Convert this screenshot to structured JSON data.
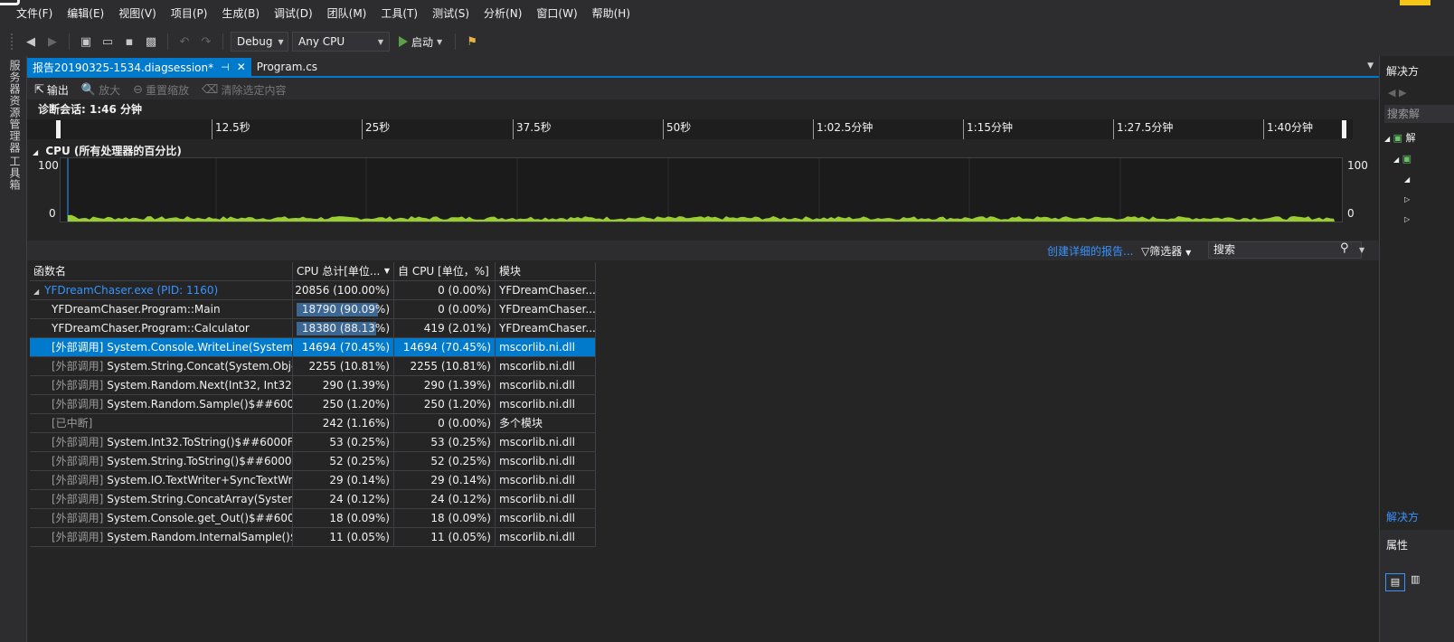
{
  "menu": [
    "文件(F)",
    "编辑(E)",
    "视图(V)",
    "项目(P)",
    "生成(B)",
    "调试(D)",
    "团队(M)",
    "工具(T)",
    "测试(S)",
    "分析(N)",
    "窗口(W)",
    "帮助(H)"
  ],
  "toolbar": {
    "config": "Debug",
    "platform": "Any CPU",
    "start_label": "启动"
  },
  "left_strip": {
    "server_explorer": "服务器资源管理器",
    "toolbox": "工具箱"
  },
  "tabs": {
    "active": "报告20190325-1534.diagsession*",
    "active_pin": "⊣",
    "active_close": "✕",
    "second": "Program.cs"
  },
  "doc_toolbar": {
    "output": "输出",
    "zoom_in": "放大",
    "reset_zoom": "重置缩放",
    "clear_selection": "清除选定内容"
  },
  "session": "诊断会话: 1:46 分钟",
  "ruler_marks": [
    "12.5秒",
    "25秒",
    "37.5秒",
    "50秒",
    "1:02.5分钟",
    "1:15分钟",
    "1:27.5分钟",
    "1:40分钟"
  ],
  "cpu_graph": {
    "title": "CPU (所有处理器的百分比)",
    "y_max": "100",
    "y_min": "0",
    "line_color": "#9acd32"
  },
  "report_bar": {
    "report_link": "创建详细的报告...",
    "filter": "筛选器",
    "search": "搜索"
  },
  "table": {
    "headers": [
      "函数名",
      "CPU 总计[单位...",
      "自 CPU [单位，%]",
      "模块"
    ],
    "rows": [
      {
        "ext": "",
        "name": "YFDreamChaser.exe (PID: 1160)",
        "total": "20856 (100.00%)",
        "self": "0 (0.00%)",
        "module": "YFDreamChaser....",
        "total_pct": 100,
        "self_pct": 0
      },
      {
        "ext": "",
        "name": "YFDreamChaser.Program::Main",
        "total": "18790 (90.09%)",
        "self": "0 (0.00%)",
        "module": "YFDreamChaser....",
        "total_pct": 90.09,
        "self_pct": 0
      },
      {
        "ext": "",
        "name": "YFDreamChaser.Program::Calculator",
        "total": "18380 (88.13%)",
        "self": "419 (2.01%)",
        "module": "YFDreamChaser....",
        "total_pct": 88.13,
        "self_pct": 2.01
      },
      {
        "ext": "[外部调用]",
        "name": "System.Console.WriteLine(System....",
        "total": "14694 (70.45%)",
        "self": "14694 (70.45%)",
        "module": "mscorlib.ni.dll",
        "total_pct": 70.45,
        "self_pct": 70.45
      },
      {
        "ext": "[外部调用]",
        "name": "System.String.Concat(System.Obje...",
        "total": "2255 (10.81%)",
        "self": "2255 (10.81%)",
        "module": "mscorlib.ni.dll",
        "total_pct": 10.81,
        "self_pct": 10.81
      },
      {
        "ext": "[外部调用]",
        "name": "System.Random.Next(Int32, Int32)...",
        "total": "290 (1.39%)",
        "self": "290 (1.39%)",
        "module": "mscorlib.ni.dll",
        "total_pct": 1.39,
        "self_pct": 1.39
      },
      {
        "ext": "[外部调用]",
        "name": "System.Random.Sample()$##6001...",
        "total": "250 (1.20%)",
        "self": "250 (1.20%)",
        "module": "mscorlib.ni.dll",
        "total_pct": 1.2,
        "self_pct": 1.2
      },
      {
        "ext": "[已中断]",
        "name": "",
        "total": "242 (1.16%)",
        "self": "0 (0.00%)",
        "module": "多个模块",
        "total_pct": 1.16,
        "self_pct": 0
      },
      {
        "ext": "[外部调用]",
        "name": "System.Int32.ToString()$##6000F47",
        "total": "53 (0.25%)",
        "self": "53 (0.25%)",
        "module": "mscorlib.ni.dll",
        "total_pct": 0.25,
        "self_pct": 0.25
      },
      {
        "ext": "[外部调用]",
        "name": "System.String.ToString()$##6000532",
        "total": "52 (0.25%)",
        "self": "52 (0.25%)",
        "module": "mscorlib.ni.dll",
        "total_pct": 0.25,
        "self_pct": 0.25
      },
      {
        "ext": "[外部调用]",
        "name": "System.IO.TextWriter+SyncTextWri...",
        "total": "29 (0.14%)",
        "self": "29 (0.14%)",
        "module": "mscorlib.ni.dll",
        "total_pct": 0.14,
        "self_pct": 0.14
      },
      {
        "ext": "[外部调用]",
        "name": "System.String.ConcatArray(System....",
        "total": "24 (0.12%)",
        "self": "24 (0.12%)",
        "module": "mscorlib.ni.dll",
        "total_pct": 0.12,
        "self_pct": 0.12
      },
      {
        "ext": "[外部调用]",
        "name": "System.Console.get_Out()$##6000...",
        "total": "18 (0.09%)",
        "self": "18 (0.09%)",
        "module": "mscorlib.ni.dll",
        "total_pct": 0.09,
        "self_pct": 0.09
      },
      {
        "ext": "[外部调用]",
        "name": "System.Random.InternalSample()$...",
        "total": "11 (0.05%)",
        "self": "11 (0.05%)",
        "module": "mscorlib.ni.dll",
        "total_pct": 0.05,
        "self_pct": 0.05
      }
    ]
  },
  "right_panel": {
    "title": "解决方",
    "search": "搜索解",
    "tree_item": "解",
    "bottom_title": "解决方",
    "properties": "属性"
  }
}
